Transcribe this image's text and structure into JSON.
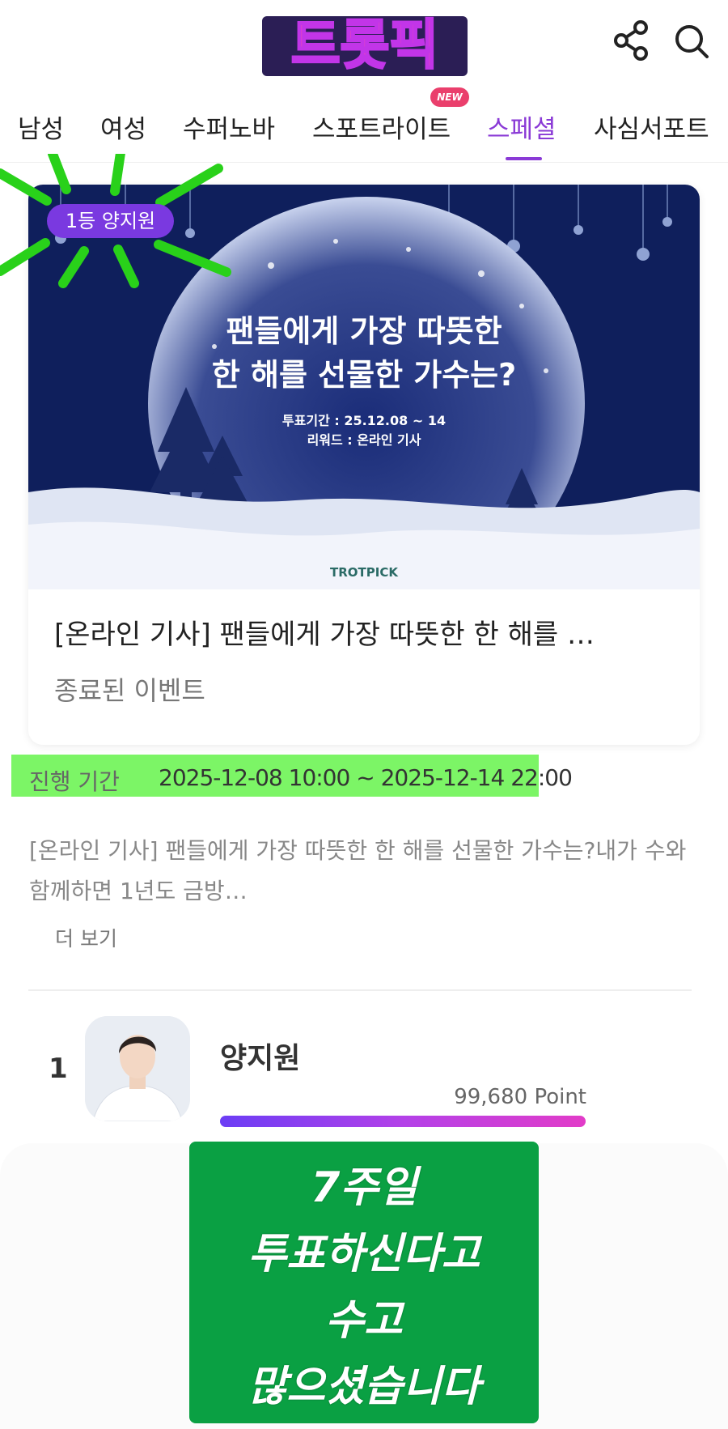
{
  "header": {
    "logo_text": "트롯픽",
    "share_label": "",
    "search_label": ""
  },
  "tabs": [
    {
      "label": "남성"
    },
    {
      "label": "여성"
    },
    {
      "label": "수퍼노바"
    },
    {
      "label": "스포트라이트",
      "badge": "NEW"
    },
    {
      "label": "스페셜",
      "active": true
    },
    {
      "label": "사심서포트"
    }
  ],
  "event": {
    "rank_badge": "1등 양지원",
    "banner_title_1": "팬들에게 가장 따뜻한",
    "banner_title_2": "한 해를 선물한 가수는?",
    "banner_period": "투표기간 : 25.12.08 ~ 14",
    "banner_reward": "리워드 : 온라인 기사",
    "banner_brand": "TROTPICK",
    "card_title": "[온라인 기사] 팬들에게 가장 따뜻한 한 해를 …",
    "card_status": "종료된 이벤트"
  },
  "period": {
    "label": "진행 기간",
    "value": "2025-12-08 10:00 ~ 2025-12-14 22:00"
  },
  "description": {
    "text": "[온라인 기사] 팬들에게 가장 따뜻한 한 해를 선물한 가수는?내가 수와 함께하면 1년도 금방…",
    "more_label": "더 보기"
  },
  "ranking": [
    {
      "rank": "1",
      "name": "양지원",
      "points": "99,680 Point",
      "progress": 1.0
    }
  ],
  "message": {
    "lines": [
      "7주일",
      "투표하신다고",
      "수고",
      "많으셨습니다"
    ]
  },
  "colors": {
    "accent": "#8a3ad6",
    "highlight": "#7cf566",
    "message_box": "#0aa043",
    "banner_bg": "#0f1f5c"
  }
}
